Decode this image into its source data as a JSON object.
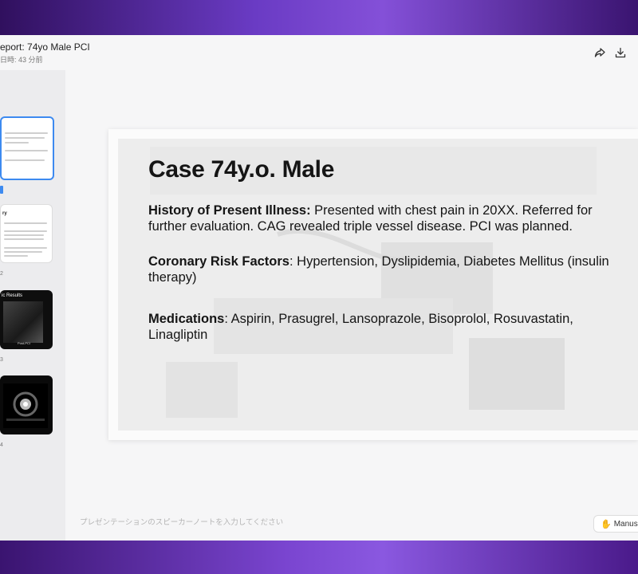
{
  "header": {
    "title": "eport: 74yo Male PCI",
    "subtitle": "日時: 43 分前",
    "share_icon": "share-icon",
    "download_icon": "download-icon"
  },
  "sidebar": {
    "thumbnails": [
      {
        "number": "",
        "heading": ""
      },
      {
        "number": "2",
        "heading": "ry"
      },
      {
        "number": "3",
        "heading": "ic Results",
        "caption": "Post-PCI"
      },
      {
        "number": "4",
        "heading": ""
      }
    ]
  },
  "slide": {
    "title": "Case 74y.o. Male",
    "sections": [
      {
        "label": "History of Present Illness:",
        "text": " Presented with chest pain in 20XX. Referred for further evaluation. CAG revealed triple vessel disease. PCI was planned."
      },
      {
        "label": "Coronary Risk Factors",
        "text": ": Hypertension, Dyslipidemia, Diabetes Mellitus (insulin therapy)"
      },
      {
        "label": "Medications",
        "text": ": Aspirin, Prasugrel, Lansoprazole, Bisoprolol, Rosuvastatin, Linagliptin"
      }
    ]
  },
  "notes": {
    "placeholder": "プレゼンテーションのスピーカーノートを入力してください"
  },
  "manus_button": {
    "label": "Manus",
    "icon": "manus-icon"
  }
}
